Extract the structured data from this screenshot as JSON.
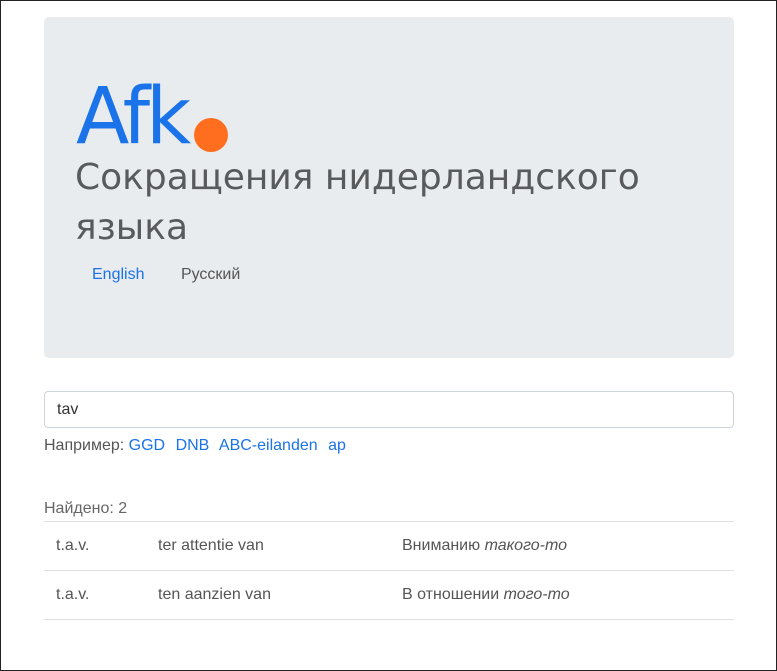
{
  "logo": {
    "text": "Afk",
    "dot_color": "#ff6d1f",
    "text_color": "#1a73e8"
  },
  "site_title": "Сокращения нидерландского языка",
  "languages": [
    {
      "label": "English",
      "active": true
    },
    {
      "label": "Русский",
      "active": false
    }
  ],
  "search": {
    "value": "tav",
    "placeholder": ""
  },
  "examples": {
    "label": "Например:",
    "items": [
      "GGD",
      "DNB",
      "ABC-eilanden",
      "ap"
    ]
  },
  "results": {
    "found_label": "Найдено: 2",
    "rows": [
      {
        "abbr": "t.a.v.",
        "dutch": "ter attentie van",
        "translation_plain": "Вниманию ",
        "translation_italic": "такого-то"
      },
      {
        "abbr": "t.a.v.",
        "dutch": "ten aanzien van",
        "translation_plain": "В отношении ",
        "translation_italic": "того-то"
      }
    ]
  }
}
